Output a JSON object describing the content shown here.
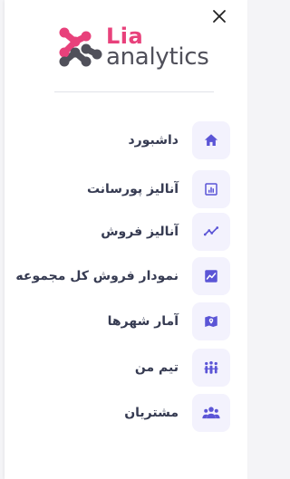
{
  "brand": {
    "name_line1": "Lia",
    "name_line2": "analytics",
    "primary_color": "#e8417b",
    "secondary_color": "#50505a",
    "accent_color": "#6c63d9"
  },
  "close": {
    "icon": "close-icon"
  },
  "menu": {
    "items": [
      {
        "label": "داشبورد",
        "icon": "home-icon"
      },
      {
        "label": "آنالیز پورسانت",
        "icon": "report-chart-icon"
      },
      {
        "label": "آنالیز فروش",
        "icon": "trending-line-icon"
      },
      {
        "label": "نمودار فروش کل مجموعه",
        "icon": "line-chart-box-icon"
      },
      {
        "label": "آمار شهرها",
        "icon": "map-pin-icon"
      },
      {
        "label": "تیم من",
        "icon": "team-icon"
      },
      {
        "label": "مشتریان",
        "icon": "customers-icon"
      }
    ]
  }
}
